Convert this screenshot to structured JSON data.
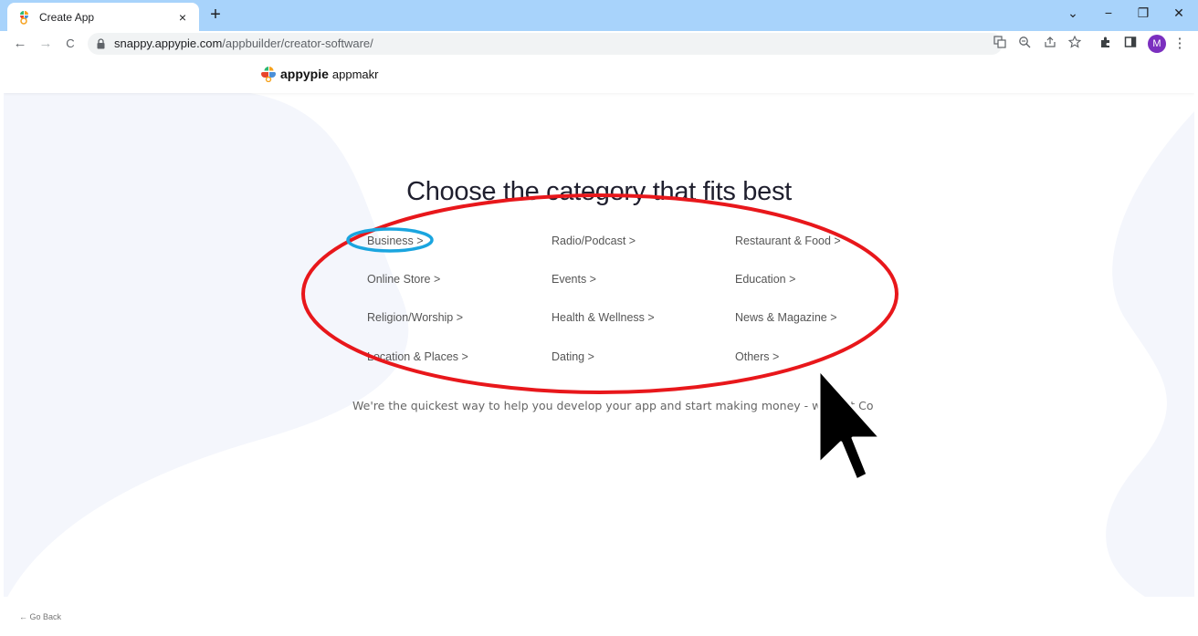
{
  "browser": {
    "tab_title": "Create App",
    "tab_close": "×",
    "new_tab": "+",
    "window_controls": {
      "collapse": "⌄",
      "minimize": "−",
      "restore": "❐",
      "close": "✕"
    },
    "nav": {
      "back": "←",
      "forward": "→",
      "reload": "C"
    },
    "url_host": "snappy.appypie.com",
    "url_path": "/appbuilder/creator-software/",
    "toolbar_icons": [
      "translate-icon",
      "zoom-icon",
      "share-icon",
      "star-icon",
      "extensions-icon",
      "sidepanel-icon"
    ],
    "avatar_letter": "M",
    "menu": "⋮"
  },
  "header": {
    "brand": "appypie",
    "product": "appmakr"
  },
  "main": {
    "heading": "Choose the category that fits best",
    "categories": [
      [
        "Business >",
        "Radio/Podcast >",
        "Restaurant & Food >"
      ],
      [
        "Online Store >",
        "Events >",
        "Education >"
      ],
      [
        "Religion/Worship >",
        "Health & Wellness >",
        "News & Magazine >"
      ],
      [
        "Location & Places >",
        "Dating >",
        "Others >"
      ]
    ],
    "tagline": "We're the quickest way to help you develop your app and start making money - without Co"
  },
  "footer": {
    "go_back": "← Go Back"
  },
  "colors": {
    "tabbar": "#a8d3fb",
    "annotation_red": "#e8171b",
    "annotation_blue": "#1aa5df",
    "avatar": "#7b2fbf"
  }
}
